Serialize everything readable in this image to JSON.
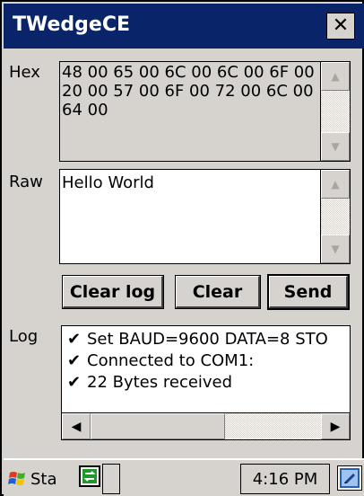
{
  "window": {
    "title": "TWedgeCE",
    "close_glyph": "✕"
  },
  "hex": {
    "label": "Hex",
    "value": "48 00 65 00 6C 00 6C 00 6F 00 20 00 57 00 6F 00 72 00 6C 00 64 00"
  },
  "raw": {
    "label": "Raw",
    "value": "Hello World"
  },
  "buttons": {
    "clear_log": "Clear log",
    "clear": "Clear",
    "send": "Send"
  },
  "log": {
    "label": "Log",
    "items": [
      {
        "check": "✔",
        "text": "Set BAUD=9600 DATA=8 STO"
      },
      {
        "check": "✔",
        "text": "Connected to COM1:"
      },
      {
        "check": "✔",
        "text": "22 Bytes received"
      }
    ]
  },
  "scroll_arrows": {
    "up": "▲",
    "down": "▼",
    "left": "◀",
    "right": "▶"
  },
  "taskbar": {
    "start_label": "Sta",
    "clock": "4:16 PM",
    "icons": [
      "windows-flag-icon",
      "sync-icon",
      "input-panel-icon"
    ]
  }
}
